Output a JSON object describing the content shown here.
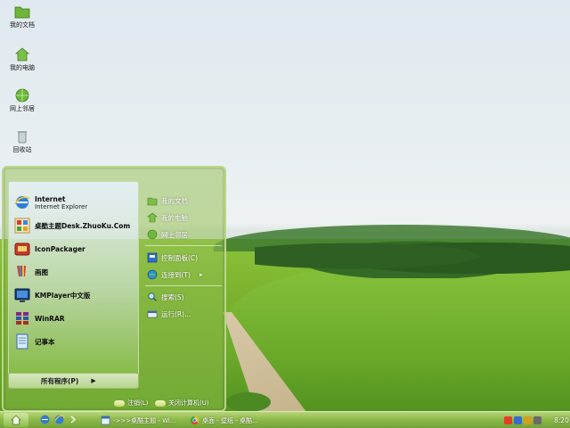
{
  "desktop": {
    "icons": [
      {
        "label": "我的文档",
        "icon": "folder-icon"
      },
      {
        "label": "我的电脑",
        "icon": "computer-icon"
      },
      {
        "label": "网上邻居",
        "icon": "network-icon"
      },
      {
        "label": "回收站",
        "icon": "recycle-bin-icon"
      }
    ]
  },
  "start_menu": {
    "programs": [
      {
        "title": "Internet",
        "subtitle": "Internet Explorer",
        "icon": "internet-explorer-icon"
      },
      {
        "title": "桌酷主题Desk.ZhuoKu.Com",
        "icon": "theme-icon"
      },
      {
        "title": "IconPackager",
        "icon": "iconpackager-icon"
      },
      {
        "title": "画图",
        "icon": "paint-icon"
      },
      {
        "title": "KMPlayer中文版",
        "icon": "kmplayer-icon"
      },
      {
        "title": "WinRAR",
        "icon": "winrar-icon"
      },
      {
        "title": "记事本",
        "icon": "notepad-icon"
      }
    ],
    "all_programs": "所有程序(P)",
    "places": [
      {
        "label": "我的文档",
        "icon": "folder-icon"
      },
      {
        "label": "我的电脑",
        "icon": "computer-icon"
      },
      {
        "label": "网上邻居",
        "icon": "network-icon"
      },
      {
        "label": "控制面板(C)",
        "icon": "control-panel-icon"
      },
      {
        "label": "连接到(T)",
        "icon": "connect-icon"
      },
      {
        "label": "搜索(S)",
        "icon": "search-icon"
      },
      {
        "label": "运行(R)...",
        "icon": "run-icon"
      }
    ],
    "logoff": "注销(L)",
    "shutdown": "关闭计算机(U)"
  },
  "taskbar": {
    "tasks": [
      {
        "label": "->>>桌酷主题 - Wi..."
      },
      {
        "label": "桌面 - 壁纸 - 桌酷..."
      }
    ],
    "clock": "8:20"
  },
  "colors": {
    "accent": "#8fbb4b",
    "taskbar_dark": "#73a238"
  }
}
